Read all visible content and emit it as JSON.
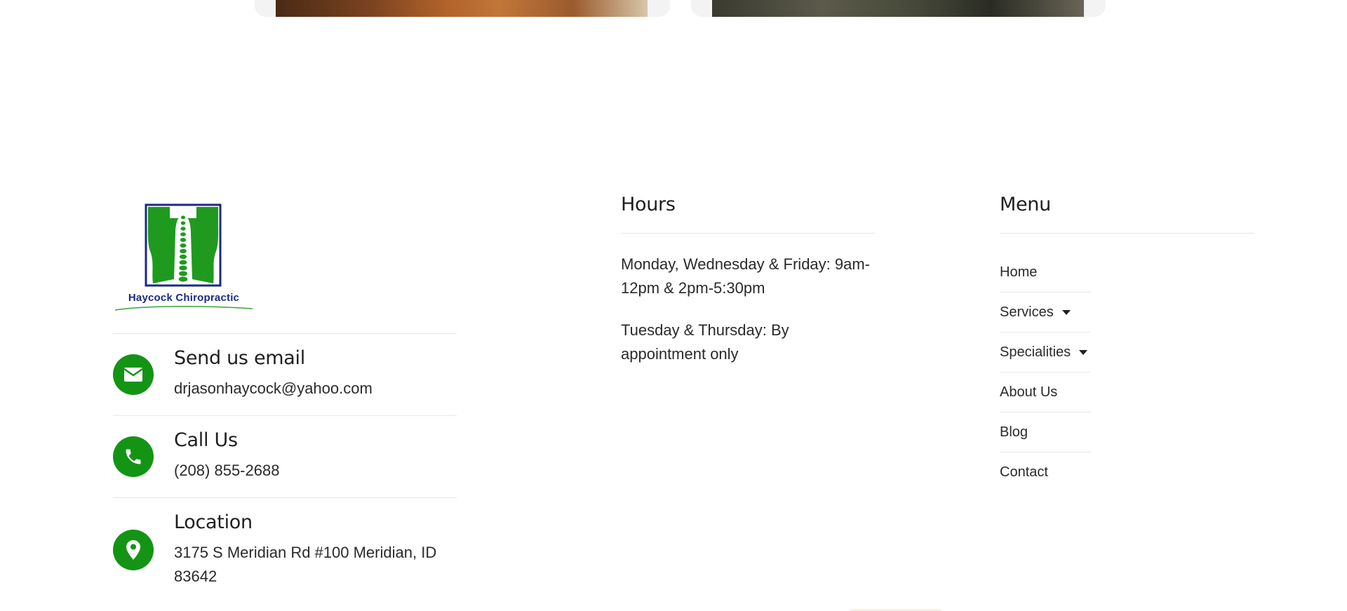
{
  "logo": {
    "text": "Haycock Chiropractic"
  },
  "contact": [
    {
      "title": "Send us email",
      "value": "drjasonhaycock@yahoo.com",
      "icon": "envelope-icon"
    },
    {
      "title": "Call Us",
      "value": "(208) 855-2688",
      "icon": "phone-icon"
    },
    {
      "title": "Location",
      "value": "3175 S Meridian Rd #100 Meridian, ID 83642",
      "icon": "map-pin-icon"
    }
  ],
  "hours": {
    "heading": "Hours",
    "lines": [
      "Monday, Wednesday & Friday: 9am-12pm & 2pm-5:30pm",
      "Tuesday & Thursday: By appointment only"
    ]
  },
  "menu": {
    "heading": "Menu",
    "items": [
      {
        "label": "Home",
        "has_submenu": false
      },
      {
        "label": "Services",
        "has_submenu": true
      },
      {
        "label": "Specialities",
        "has_submenu": true
      },
      {
        "label": "About Us",
        "has_submenu": false
      },
      {
        "label": "Blog",
        "has_submenu": false
      },
      {
        "label": "Contact",
        "has_submenu": false
      }
    ]
  },
  "colors": {
    "accent": "#149414",
    "logo_blue": "#1b2a86"
  }
}
